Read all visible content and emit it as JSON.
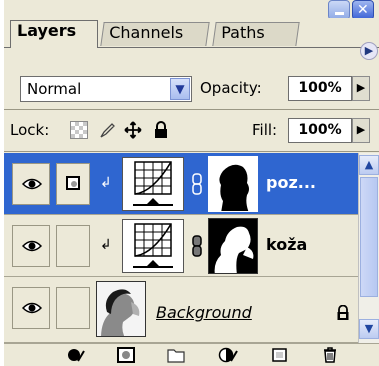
{
  "tabs": [
    {
      "label": "Layers",
      "active": true
    },
    {
      "label": "Channels",
      "active": false
    },
    {
      "label": "Paths",
      "active": false
    }
  ],
  "blend_mode": {
    "value": "Normal"
  },
  "opacity": {
    "label": "Opacity:",
    "value": "100%"
  },
  "lock": {
    "label": "Lock:",
    "icons": [
      "lock-transparent-icon",
      "brush-icon",
      "move-icon",
      "padlock-icon"
    ]
  },
  "fill": {
    "label": "Fill:",
    "value": "100%"
  },
  "layers": [
    {
      "name": "poz...",
      "selected": true,
      "visible": true,
      "type": "adjustment-curves"
    },
    {
      "name": "koža",
      "selected": false,
      "visible": true,
      "type": "adjustment-curves"
    },
    {
      "name": "Background",
      "selected": false,
      "visible": true,
      "type": "image",
      "locked": true
    }
  ],
  "colors": {
    "selection": "#2f66d0",
    "panel": "#ece9d8"
  },
  "bottom_icons": [
    "link-icon",
    "layer-style-icon",
    "add-mask-icon",
    "new-group-icon",
    "adjustment-layer-icon",
    "new-layer-icon",
    "trash-icon"
  ]
}
